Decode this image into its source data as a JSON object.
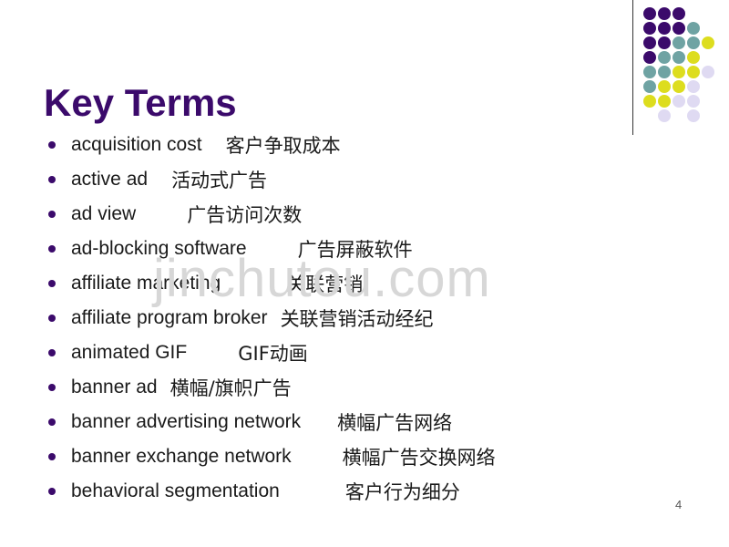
{
  "slide": {
    "title": "Key Terms",
    "page_number": "4",
    "watermark": "jinchutou.com",
    "background_color": "#FFFFFF",
    "title_color": "#3B0A6B",
    "body_text_color": "#1A1A1A",
    "watermark_color": "#D7D7D7"
  },
  "decoration": {
    "name": "dot-grid",
    "rule_color": "#333333",
    "colors": {
      "purple": "#3B0A6B",
      "teal": "#6FA3A3",
      "yellow": "#DDDD1E",
      "lavender": "#DFDAF2"
    },
    "dots": [
      {
        "row": 0,
        "col": 0,
        "color": "purple"
      },
      {
        "row": 0,
        "col": 1,
        "color": "purple"
      },
      {
        "row": 0,
        "col": 2,
        "color": "purple"
      },
      {
        "row": 1,
        "col": 0,
        "color": "purple"
      },
      {
        "row": 1,
        "col": 1,
        "color": "purple"
      },
      {
        "row": 1,
        "col": 2,
        "color": "purple"
      },
      {
        "row": 1,
        "col": 3,
        "color": "teal"
      },
      {
        "row": 2,
        "col": 0,
        "color": "purple"
      },
      {
        "row": 2,
        "col": 1,
        "color": "purple"
      },
      {
        "row": 2,
        "col": 2,
        "color": "teal"
      },
      {
        "row": 2,
        "col": 3,
        "color": "teal"
      },
      {
        "row": 2,
        "col": 4,
        "color": "yellow"
      },
      {
        "row": 3,
        "col": 0,
        "color": "purple"
      },
      {
        "row": 3,
        "col": 1,
        "color": "teal"
      },
      {
        "row": 3,
        "col": 2,
        "color": "teal"
      },
      {
        "row": 3,
        "col": 3,
        "color": "yellow"
      },
      {
        "row": 4,
        "col": 0,
        "color": "teal"
      },
      {
        "row": 4,
        "col": 1,
        "color": "teal"
      },
      {
        "row": 4,
        "col": 2,
        "color": "yellow"
      },
      {
        "row": 4,
        "col": 3,
        "color": "yellow"
      },
      {
        "row": 4,
        "col": 4,
        "color": "lavender"
      },
      {
        "row": 5,
        "col": 0,
        "color": "teal"
      },
      {
        "row": 5,
        "col": 1,
        "color": "yellow"
      },
      {
        "row": 5,
        "col": 2,
        "color": "yellow"
      },
      {
        "row": 5,
        "col": 3,
        "color": "lavender"
      },
      {
        "row": 6,
        "col": 0,
        "color": "yellow"
      },
      {
        "row": 6,
        "col": 1,
        "color": "yellow"
      },
      {
        "row": 6,
        "col": 2,
        "color": "lavender"
      },
      {
        "row": 6,
        "col": 3,
        "color": "lavender"
      },
      {
        "row": 7,
        "col": 1,
        "color": "lavender"
      },
      {
        "row": 7,
        "col": 3,
        "color": "lavender"
      }
    ]
  },
  "terms": [
    {
      "en": "acquisition cost",
      "zh": "客户争取成本",
      "gap": "gap-m"
    },
    {
      "en": "active ad",
      "zh": "活动式广告",
      "gap": "gap-m"
    },
    {
      "en": "ad view",
      "zh": "广告访问次数",
      "gap": "gap-xl"
    },
    {
      "en": "ad-blocking software",
      "zh": "广告屏蔽软件",
      "gap": "gap-xl"
    },
    {
      "en": "affiliate marketing",
      "zh": "关联营销",
      "gap": "gap-xxl"
    },
    {
      "en": "affiliate program broker",
      "zh": "关联营销活动经纪",
      "gap": "gap-s"
    },
    {
      "en": "animated GIF",
      "zh": "GIF动画",
      "gap": "gap-xl"
    },
    {
      "en": "banner ad",
      "zh": "横幅/旗帜广告",
      "gap": "gap-s"
    },
    {
      "en": "banner advertising network",
      "zh": "横幅广告网络",
      "gap": "gap-l"
    },
    {
      "en": "banner exchange network",
      "zh": "横幅广告交换网络",
      "gap": "gap-xl"
    },
    {
      "en": "behavioral segmentation",
      "zh": "客户行为细分",
      "gap": "gap-xxl"
    }
  ]
}
